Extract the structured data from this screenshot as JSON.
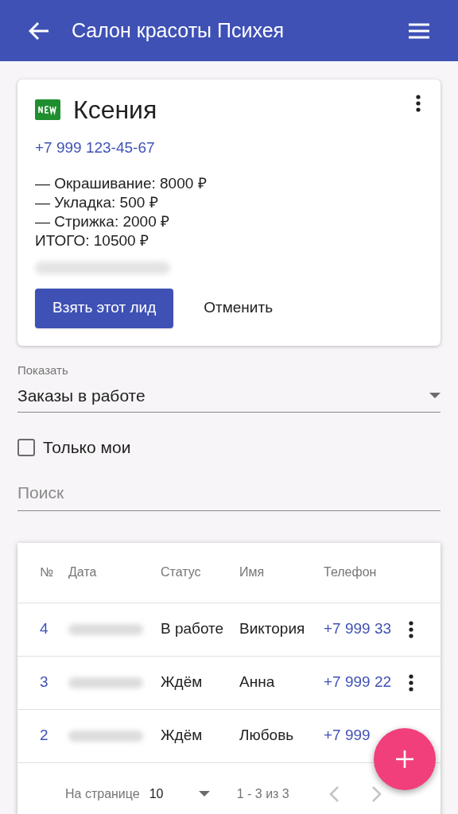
{
  "app_bar": {
    "title": "Салон красоты Психея"
  },
  "lead": {
    "name": "Ксения",
    "phone": "+7 999 123-45-67",
    "lines": [
      "— Окрашивание: 8000 ₽",
      "— Укладка: 500 ₽",
      "— Стрижка: 2000 ₽",
      "ИТОГО: 10500 ₽"
    ],
    "buttons": [
      {
        "label": "Взять этот лид",
        "kind": "primary"
      },
      {
        "label": "Отменить",
        "kind": "text"
      }
    ]
  },
  "filter": {
    "label": "Показать",
    "value": "Заказы в работе"
  },
  "only_mine": {
    "label": "Только мои",
    "checked": false
  },
  "search": {
    "placeholder": "Поиск"
  },
  "table": {
    "columns": [
      "№",
      "Дата",
      "Статус",
      "Имя",
      "Телефон"
    ],
    "rows": [
      {
        "number": "4",
        "status": "В работе",
        "name": "Виктория",
        "phone": "+7 999 33",
        "menu": true
      },
      {
        "number": "3",
        "status": "Ждём",
        "name": "Анна",
        "phone": "+7 999 22",
        "menu": true
      },
      {
        "number": "2",
        "status": "Ждём",
        "name": "Любовь",
        "phone": "+7 999",
        "menu": false
      }
    ],
    "pagination": {
      "label": "На странице",
      "per_page": "10",
      "range": "1 - 3 из 3"
    }
  }
}
